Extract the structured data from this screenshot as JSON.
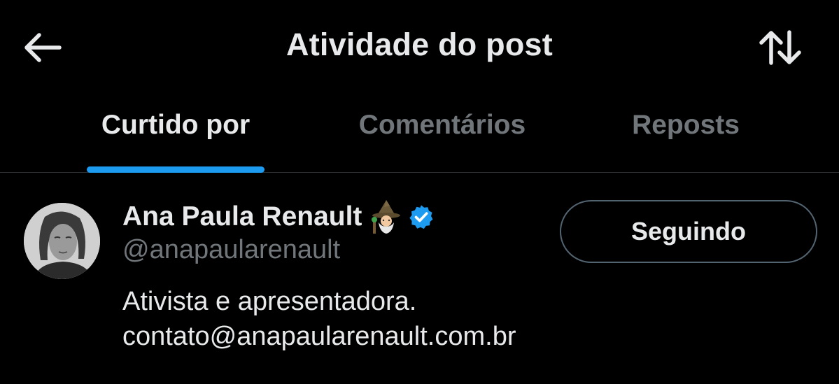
{
  "header": {
    "title": "Atividade do post",
    "back_icon": "arrow-left-icon",
    "sort_icon": "sort-arrows-icon"
  },
  "tabs": [
    {
      "label": "Curtido por",
      "active": true
    },
    {
      "label": "Comentários",
      "active": false
    },
    {
      "label": "Reposts",
      "active": false
    }
  ],
  "user": {
    "name": "Ana Paula Renault",
    "emoji_icon": "mage-icon",
    "verified_icon": "verified-badge-icon",
    "handle": "@anapaularenault",
    "bio_line1": "Ativista e apresentadora.",
    "bio_line2": "contato@anapaularenault.com.br",
    "follow_label": "Seguindo"
  },
  "colors": {
    "background": "#000000",
    "text_primary": "#e7e9ea",
    "text_secondary": "#71767b",
    "accent": "#1d9bf0",
    "divider": "#2f3336"
  }
}
